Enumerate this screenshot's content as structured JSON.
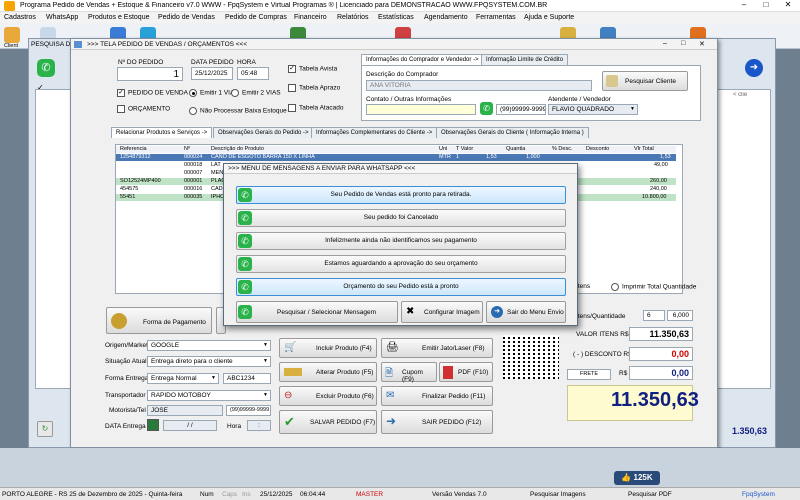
{
  "app": {
    "title": "Programa Pedido de Vendas + Estoque & Financeiro v7.0 WWW - FpqSystem e Virtual Programas ® | Licenciado para  DEMONSTRACAO WWW.FPQSYSTEM.COM.BR"
  },
  "menu": [
    "Cadastros",
    "WhatsApp",
    "Produtos e Estoque",
    "Pedido de Vendas",
    "Pedido de Compras",
    "Financeiro",
    "Relatórios",
    "Estatísticas",
    "Agendamento",
    "Ferramentas",
    "Ajuda e Suporte"
  ],
  "toolbar": {
    "cliente_label": "Client"
  },
  "background_window": {
    "title": "PESQUISA DOS"
  },
  "main_window": {
    "title": ">>>  TELA PEDIDO DE VENDAS / ORÇAMENTOS  <<<",
    "numero_pedido_label": "Nº DO PEDIDO",
    "numero_pedido": "1",
    "data_pedido_label": "DATA PEDIDO",
    "data_pedido": "25/12/2025",
    "hora_label": "HORA",
    "hora": "05:48",
    "tabela_avista": "Tabela Avista",
    "tabela_aprazo": "Tabela Aprazo",
    "tabela_atacado": "Tabela Atacado",
    "pedido_de_venda": "PEDIDO DE VENDA",
    "orcamento": "ORÇAMENTO",
    "emitir_1via": "Emitir 1 VIA",
    "emitir_2vias": "Emitir 2 VIAS",
    "nao_processar": "Não Processar Baixa Estoque",
    "tab_comprador": "Informações do Comprador e Vendedor  ->",
    "tab_limite": "Informação Limite de Crédito",
    "descricao_comprador_label": "Descrição do Comprador",
    "descricao_comprador": "ANA VITORIA",
    "pesquisar_cliente": "Pesquisar Cliente",
    "contato_label": "Contato / Outras Informações",
    "telefone": "(99)99999-9999",
    "atendente_label": "Atendente / Vendedor",
    "atendente": "FLAVIO QUADRADO",
    "tabs": [
      "Relacionar Produtos e Serviços  ->",
      "Observações Gerais do Pedido  ->",
      "Informações Complementares do Cliente  ->",
      "Observações Gerais do Cliente ( Informação Interna )"
    ],
    "grid_headers": [
      "Referencia",
      "Nº",
      "Descrição do Produto",
      "Uni",
      "T Valor",
      "Quantia",
      "% Desc.",
      "Desconto",
      "Vlr Total"
    ],
    "grid_rows": [
      {
        "ref": "1254879312",
        "num": "000024",
        "desc": "CANO DE ESGOTO BARRA 150 X LINHA",
        "uni": "MTR",
        "tv": "1",
        "vl": "1,53",
        "qt": "1,000",
        "total": "1,53"
      },
      {
        "ref": "",
        "num": "000018",
        "desc": "LAT",
        "uni": "",
        "tv": "",
        "vl": "",
        "qt": "",
        "total": "49,00"
      },
      {
        "ref": "",
        "num": "000007",
        "desc": "MEN",
        "uni": "",
        "tv": "",
        "vl": "",
        "qt": "",
        "total": ""
      },
      {
        "ref": "SO12524MP400",
        "num": "000001",
        "desc": "PLAC",
        "uni": "",
        "tv": "",
        "vl": "",
        "qt": "",
        "total": "260,00"
      },
      {
        "ref": "454575",
        "num": "000016",
        "desc": "CAD",
        "uni": "",
        "tv": "",
        "vl": "",
        "qt": "",
        "total": "240,00"
      },
      {
        "ref": "55451",
        "num": "000035",
        "desc": "IPHO",
        "uni": "",
        "tv": "",
        "vl": "",
        "qt": "",
        "total": "10.800,00"
      }
    ],
    "itens_label": "Itens",
    "imprimir_total": "Imprimir Total Quantidade",
    "forma_pagamento": "Forma de Pagamento",
    "itens_quantidade_label": "Itens/Quantidade",
    "itens_count": "6",
    "quantidade_total": "6,000",
    "valor_itens_label": "VALOR ITENS R$",
    "valor_itens": "11.350,63",
    "desconto_label": "( - ) DESCONTO R$",
    "desconto": "0,00",
    "frete_label": "FRETE",
    "frete_currency": "R$",
    "frete": "0,00",
    "total": "11.350,63",
    "origem_label": "Origem/Market",
    "origem": "GOOGLE",
    "situacao_label": "Situação Atual",
    "situacao": "Entrega direto para o cliente",
    "forma_entrega_label": "Forma Entrega",
    "forma_entrega": "Entrega Normal",
    "codigo_entrega": "ABC1234",
    "transportador_label": "Transportador",
    "transportador": "RAPIDO MOTOBOY",
    "motorista_label": "Motorista/Tel",
    "motorista": "JOSE",
    "motorista_tel": "(99)99999-9999",
    "data_entrega_label": "DATA Entrega",
    "data_entrega": "/ /",
    "hora_entrega_label": "Hora",
    "hora_entrega": ":",
    "incluir_produto": "Incluir Produto  (F4)",
    "emitir_jato": "Emitir Jato/Laser (F8)",
    "alterar_produto": "Alterar Produto  (F5)",
    "cupom": "Cupom (F9)",
    "pdf": "PDF (F10)",
    "excluir_produto": "Excluir Produto  (F6)",
    "finalizar_pedido": "Finalizar Pedido  (F11)",
    "salvar_pedido": "SALVAR PEDIDO (F7)",
    "sair_pedido": "SAIR  PEDIDO  (F12)"
  },
  "modal": {
    "title": ">>> MENU DE MENSAGENS A ENVIAR PARA WHATSAPP <<<",
    "messages": [
      "Seu Pedido de Vendas está pronto para retirada.",
      "Seu pedido foi Cancelado",
      "Infelizmente ainda não identificamos seu pagamento",
      "Estamos aguardando a aprovação do seu orçamento",
      "Orçamento do seu Pedido está a pronto"
    ],
    "pesquisar_mensagem": "Pesquisar / Selecionar Mensagem",
    "configurar_imagem": "Configurar Imagem",
    "sair_menu": "Sair do Menu Envio"
  },
  "background_right": {
    "total": "1.350,63",
    "cliente_hint": "< clie"
  },
  "badge": {
    "count": "125K"
  },
  "statusbar": {
    "city_date": "PORTO ALEGRE - RS 25 de Dezembro de 2025 - Quinta-feira",
    "num": "Num",
    "caps": "Caps",
    "ins": "Ins",
    "date": "25/12/2025",
    "time": "06:04:44",
    "user": "MASTER",
    "version": "Versão Vendas 7.0",
    "pesquisar_imagens": "Pesquisar Imagens",
    "pesquisar_pdf": "Pesquisar PDF",
    "brand": "FpqSystem"
  },
  "colors": {
    "accent": "#1a56c8",
    "whatsapp": "#29b34a",
    "red_value": "#d00000"
  }
}
